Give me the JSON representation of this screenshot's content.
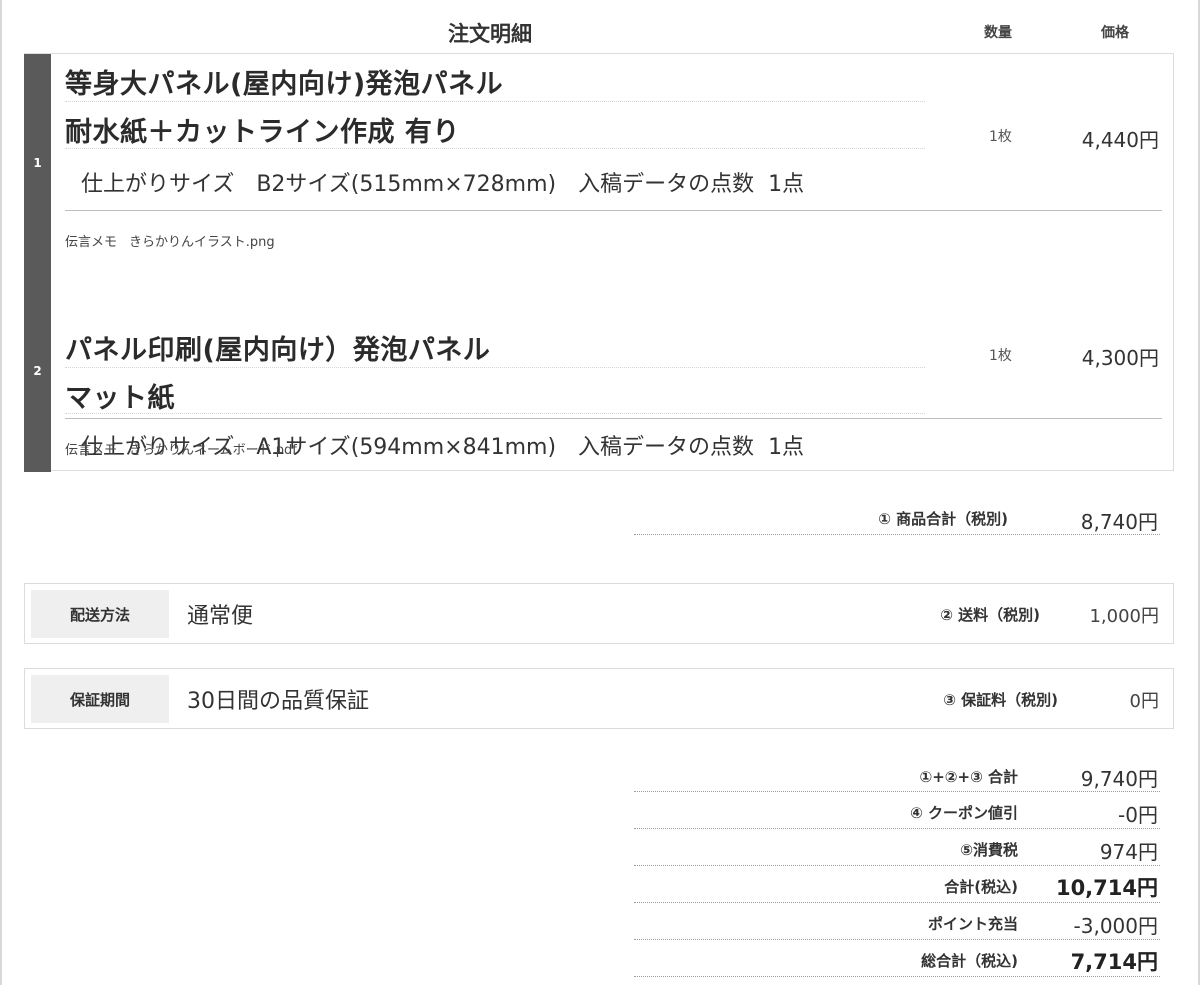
{
  "header": {
    "title": "注文明細",
    "qty_label": "数量",
    "price_label": "価格"
  },
  "items": [
    {
      "number": "1",
      "title_line1": "等身大パネル(屋内向け)発泡パネル",
      "title_line2": "耐水紙＋カットライン作成 有り",
      "size_label": "仕上がりサイズ",
      "size_value": "B2サイズ(515mm×728mm)",
      "data_count_label": "入稿データの点数",
      "data_count_value": "1点",
      "qty": "1枚",
      "price": "4,440円",
      "memo_label": "伝言メモ",
      "memo_value": "きらかりんイラスト.png"
    },
    {
      "number": "2",
      "title_line1": "パネル印刷(屋内向け）発泡パネル",
      "title_line2": "マット紙",
      "size_label": "仕上がりサイズ",
      "size_value": "A1サイズ(594mm×841mm)",
      "data_count_label": "入稿データの点数",
      "data_count_value": "1点",
      "qty": "1枚",
      "price": "4,300円",
      "memo_label": "伝言メモ",
      "memo_value": "きらかりんネームボード.pdf"
    }
  ],
  "subtotal": {
    "label": "① 商品合計（税別)",
    "value": "8,740円"
  },
  "shipping": {
    "label": "配送方法",
    "value": "通常便",
    "fee_label": "② 送料（税別)",
    "fee_value": "1,000円"
  },
  "warranty": {
    "label": "保証期間",
    "value": "30日間の品質保証",
    "fee_label": "③ 保証料（税別)",
    "fee_value": "0円"
  },
  "totals": [
    {
      "label": "①+②+③ 合計",
      "value": "9,740円"
    },
    {
      "label": "④ クーポン値引",
      "value": "-0円"
    },
    {
      "label": "⑤消費税",
      "value": "974円"
    },
    {
      "label": "合計(税込)",
      "value": "10,714円"
    },
    {
      "label": "ポイント充当",
      "value": "-3,000円"
    },
    {
      "label": "総合計（税込)",
      "value": "7,714円"
    }
  ]
}
